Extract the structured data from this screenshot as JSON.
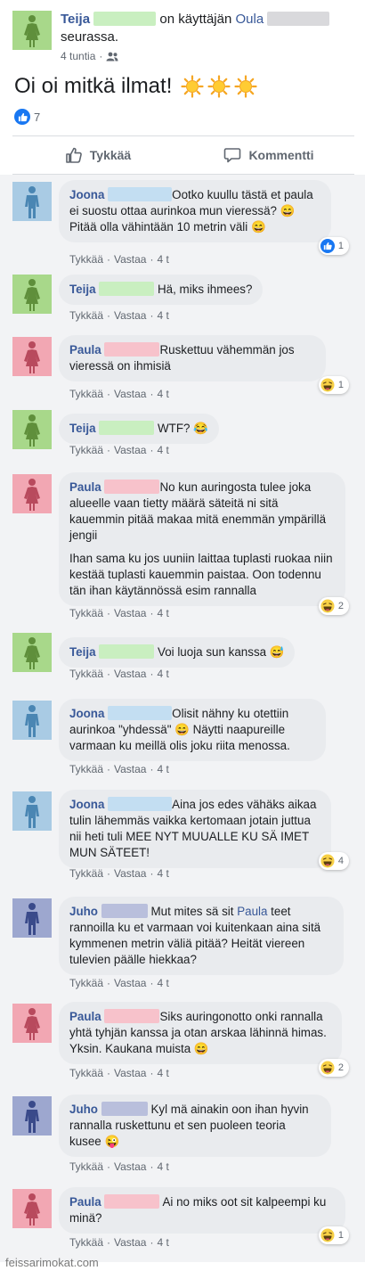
{
  "colors": {
    "green_avatar": "#a8d88a",
    "green_figure": "#5f8f3b",
    "blue_avatar": "#a9cbe4",
    "blue_figure": "#4a86b3",
    "pink_avatar": "#f2a7b3",
    "pink_figure": "#b84a5d",
    "navy_avatar": "#9da7cf",
    "navy_figure": "#3a4a8a",
    "link": "#385898",
    "bubble": "#e9ebee"
  },
  "post": {
    "author": "Teija",
    "text_on": "on käyttäjän",
    "tagged": "Oula",
    "text_following": "seurassa.",
    "time": "4 tuntia",
    "audience_icon": "friends-icon",
    "message": "Oi oi mitkä ilmat!",
    "emoji": [
      "sun-icon",
      "sun-icon",
      "sun-icon"
    ],
    "like_count": "7"
  },
  "actions": {
    "like": "Tykkää",
    "comment": "Kommentti"
  },
  "comment_actions": {
    "like": "Tykkää",
    "reply": "Vastaa",
    "dot": "·"
  },
  "comments": [
    {
      "author": "Joona",
      "color": "blue",
      "paragraphs": [
        "Ootko kuullu tästä et paula ei suostu ottaa aurinkoa mun vieressä? 😄 Pitää olla vähintään 10 metrin väli 😄"
      ],
      "time": "4 t",
      "reaction": "like-icon",
      "reaction_count": "1"
    },
    {
      "author": "Teija",
      "color": "green",
      "paragraphs": [
        "Hä, miks ihmees?"
      ],
      "time": "4 t"
    },
    {
      "author": "Paula",
      "color": "pink",
      "paragraphs": [
        "Ruskettuu vähemmän jos vieressä on ihmisiä"
      ],
      "time": "4 t",
      "reaction": "haha-icon",
      "reaction_count": "1"
    },
    {
      "author": "Teija",
      "color": "green",
      "paragraphs": [
        "WTF? 😂"
      ],
      "time": "4 t"
    },
    {
      "author": "Paula",
      "color": "pink",
      "paragraphs": [
        "No kun auringosta tulee joka alueelle vaan tietty määrä säteitä ni sitä kauemmin pitää makaa mitä enemmän ympärillä jengii",
        "Ihan sama ku jos uuniin laittaa tuplasti ruokaa niin kestää tuplasti kauemmin paistaa. Oon todennu tän ihan käytännössä esim rannalla"
      ],
      "time": "4 t",
      "reaction": "haha-icon",
      "reaction_count": "2"
    },
    {
      "author": "Teija",
      "color": "green",
      "paragraphs": [
        "Voi luoja sun kanssa 😅"
      ],
      "time": "4 t"
    },
    {
      "author": "Joona",
      "color": "blue",
      "paragraphs": [
        "Olisit nähny ku otettiin aurinkoa \"yhdessä\" 😄 Näytti naapureille varmaan ku meillä olis joku riita menossa."
      ],
      "time": "4 t"
    },
    {
      "author": "Joona",
      "color": "blue",
      "paragraphs": [
        "Aina jos edes vähäks aikaa tulin lähemmäs vaikka kertomaan jotain juttua nii heti tuli MEE NYT MUUALLE KU SÄ IMET MUN SÄTEET!"
      ],
      "time": "4 t",
      "reaction": "haha-icon",
      "reaction_count": "4"
    },
    {
      "author": "Juho",
      "color": "navy",
      "paragraphs_pre": "Mut mites sä sit ",
      "mention": "Paula",
      "paragraphs_post": " teet rannoilla ku et varmaan voi kuitenkaan aina sitä kymmenen metrin väliä pitää? Heität viereen tulevien päälle hiekkaa?",
      "time": "4 t"
    },
    {
      "author": "Paula",
      "color": "pink",
      "paragraphs": [
        "Siks auringonotto onki rannalla yhtä tyhjän kanssa ja otan arskaa lähinnä himas. Yksin. Kaukana muista 😄"
      ],
      "time": "4 t",
      "reaction": "haha-icon",
      "reaction_count": "2"
    },
    {
      "author": "Juho",
      "color": "navy",
      "paragraphs": [
        "Kyl mä ainakin oon ihan hyvin rannalla ruskettunu et sen puoleen teoria kusee 😜"
      ],
      "time": "4 t"
    },
    {
      "author": "Paula",
      "color": "pink",
      "paragraphs": [
        "Ai no miks oot sit kalpeempi ku minä?"
      ],
      "time": "4 t",
      "reaction": "haha-icon",
      "reaction_count": "1"
    }
  ],
  "watermark": "feissarimokat.com"
}
